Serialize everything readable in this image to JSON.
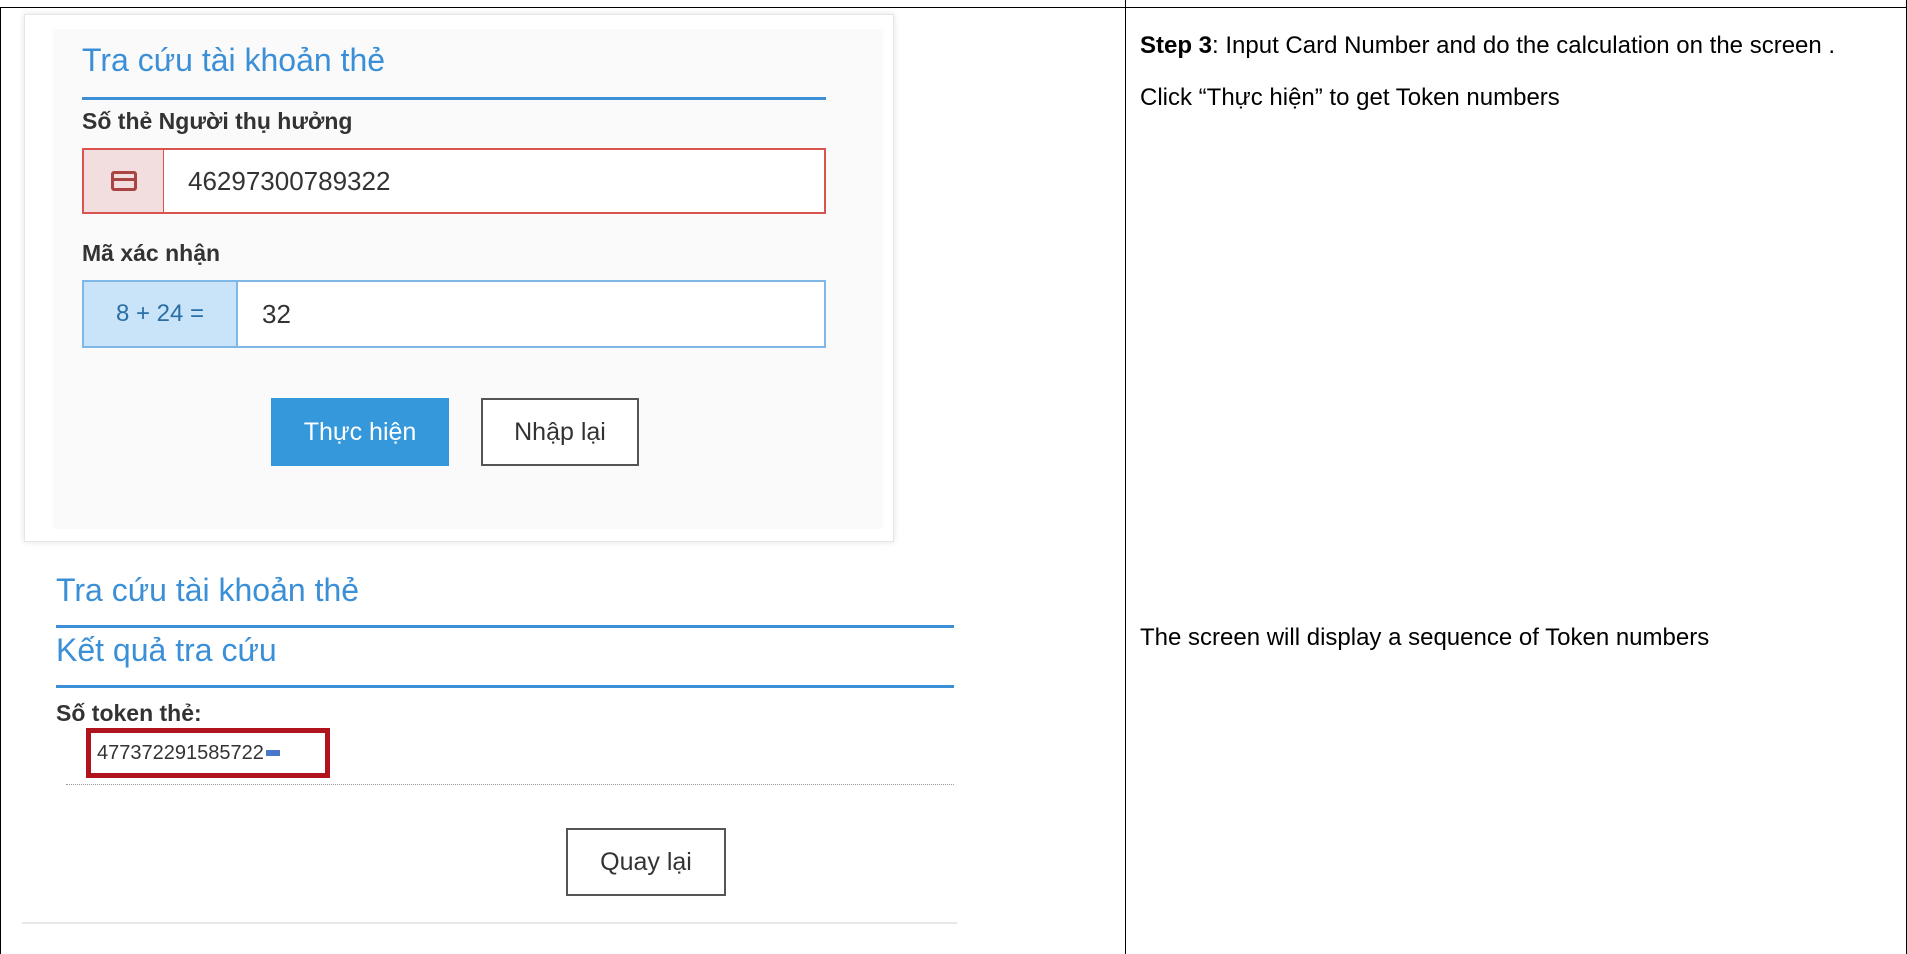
{
  "lookup_form": {
    "title": "Tra cứu tài khoản thẻ",
    "card_label": "Số thẻ Người thụ hưởng",
    "card_value": "46297300789322",
    "card_icon": "credit-card-icon",
    "captcha_label": "Mã xác nhận",
    "captcha_question": "8 + 24 =",
    "captcha_value": "32",
    "submit_label": "Thực hiện",
    "reset_label": "Nhập lại"
  },
  "result_panel": {
    "title": "Tra cứu tài khoản thẻ",
    "subtitle": "Kết quả tra cứu",
    "token_label": "Số token thẻ:",
    "token_value": "477372291585722",
    "back_label": "Quay lại",
    "highlight_color": "#b0131b"
  },
  "instructions": {
    "step_prefix": "Step 3",
    "step_body": ": Input Card Number and do the calculation on the screen . Click “Thực hiện” to get Token numbers",
    "result_text": "The screen will display a sequence of Token numbers"
  },
  "colors": {
    "accent_blue": "#3a8fd6",
    "button_blue": "#3498db",
    "error_red": "#d9534f"
  }
}
